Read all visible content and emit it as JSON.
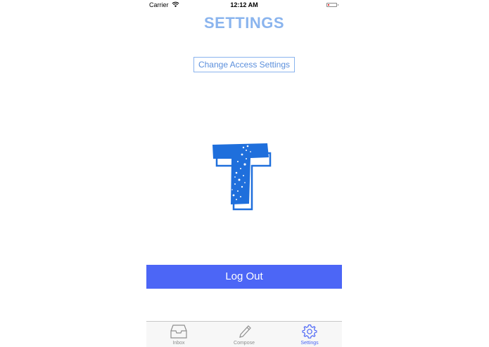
{
  "status_bar": {
    "carrier": "Carrier",
    "time": "12:12 AM",
    "battery_color": "#e03030"
  },
  "header": {
    "title": "SETTINGS"
  },
  "main": {
    "change_access_label": "Change Access Settings",
    "logo_icon": "letter-t-logo",
    "logout_label": "Log Out"
  },
  "tab_bar": {
    "tabs": [
      {
        "label": "Inbox",
        "icon": "inbox-tray-icon",
        "active": false
      },
      {
        "label": "Compose",
        "icon": "pencil-icon",
        "active": false
      },
      {
        "label": "Settings",
        "icon": "gear-icon",
        "active": true
      }
    ]
  },
  "colors": {
    "accent": "#4c66f6",
    "title": "#8ab4ee",
    "logo": "#1f6fdc"
  }
}
